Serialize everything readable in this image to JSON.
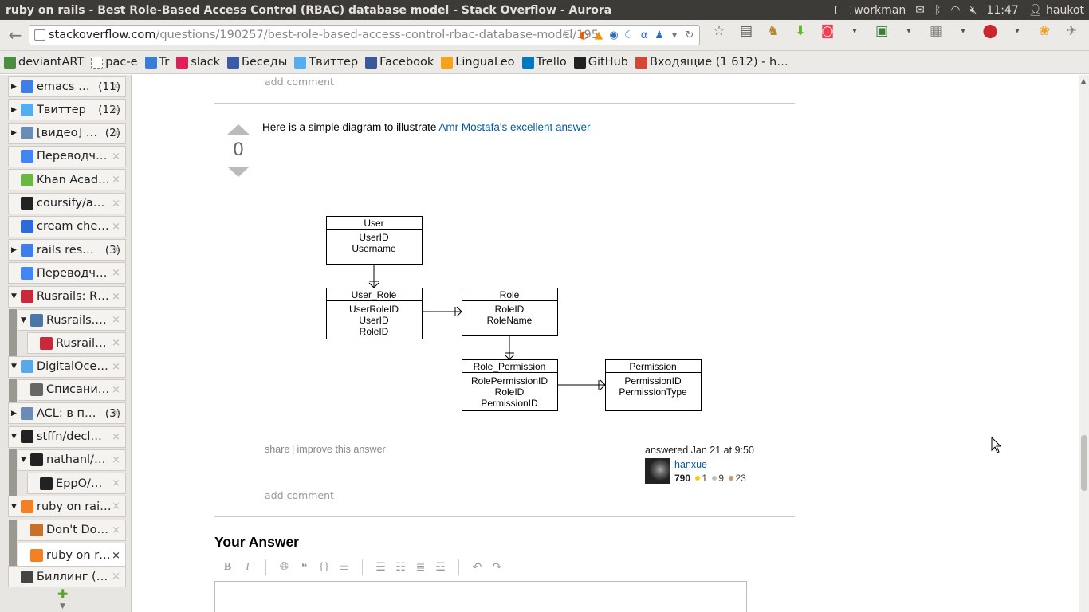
{
  "window": {
    "title": "ruby on rails - Best Role-Based Access Control (RBAC) database model - Stack Overflow - Aurora"
  },
  "system_tray": {
    "keyboard_layout": "workman",
    "time": "11:47",
    "user": "haukot"
  },
  "url": {
    "host": "stackoverflow.com",
    "path": "/questions/190257/best-role-based-access-control-rbac-database-model/195"
  },
  "bookmarks": [
    {
      "label": "deviantART",
      "icon_color": "#4a8e3f"
    },
    {
      "label": "рас-е",
      "icon_color": "#ffffff"
    },
    {
      "label": "Tr",
      "icon_color": "#3a7bd5"
    },
    {
      "label": "slack",
      "icon_color": "#e01e5a"
    },
    {
      "label": "Беседы",
      "icon_color": "#3b5ba7"
    },
    {
      "label": "Твиттер",
      "icon_color": "#55acee"
    },
    {
      "label": "Facebook",
      "icon_color": "#3b5998"
    },
    {
      "label": "LinguaLeo",
      "icon_color": "#f6a21e"
    },
    {
      "label": "Trello",
      "icon_color": "#0079bf"
    },
    {
      "label": "GitHub",
      "icon_color": "#222222"
    },
    {
      "label": "Входящие (1 612) - h…",
      "icon_color": "#d14836"
    }
  ],
  "sidebar": {
    "tabs": [
      {
        "label": "emacs …",
        "count": "(11)",
        "icon": "google-icon",
        "icon_color": "#3f7ee8",
        "twisty": "▶"
      },
      {
        "label": "Твиттер",
        "count": "(12)",
        "icon": "twitter-icon",
        "icon_color": "#55acee",
        "twisty": "▶"
      },
      {
        "label": "[видео] …",
        "count": "(2)",
        "icon": "page-icon",
        "icon_color": "#6a8bb3",
        "twisty": "▶"
      },
      {
        "label": "Переводч…",
        "count": "",
        "icon": "translate-icon",
        "icon_color": "#4285f4",
        "twisty": ""
      },
      {
        "label": "Khan Acad…",
        "count": "",
        "icon": "leaf-icon",
        "icon_color": "#69b745",
        "twisty": ""
      },
      {
        "label": "coursify/a…",
        "count": "",
        "icon": "github-icon",
        "icon_color": "#222",
        "twisty": ""
      },
      {
        "label": "cream che…",
        "count": "",
        "icon": "c-icon",
        "icon_color": "#2c6bd9",
        "twisty": ""
      },
      {
        "label": "rails res…",
        "count": "(3)",
        "icon": "google-icon",
        "icon_color": "#3f7ee8",
        "twisty": "▶"
      },
      {
        "label": "Переводч…",
        "count": "",
        "icon": "translate-icon",
        "icon_color": "#4285f4",
        "twisty": ""
      },
      {
        "label": "Rusrails: R…",
        "count": "",
        "icon": "rusrails-icon",
        "icon_color": "#c8283a",
        "twisty": "▼"
      },
      {
        "label": "Rusrails.…",
        "count": "",
        "icon": "vk-icon",
        "icon_color": "#4a76a8",
        "twisty": "▼"
      },
      {
        "label": "Rusrail…",
        "count": "",
        "icon": "rusrails-icon",
        "icon_color": "#c8283a",
        "twisty": ""
      },
      {
        "label": "DigitalOce…",
        "count": "",
        "icon": "cloud-icon",
        "icon_color": "#5aa9e6",
        "twisty": "▼"
      },
      {
        "label": "Списани…",
        "count": "",
        "icon": "cloud-icon",
        "icon_color": "#666",
        "twisty": ""
      },
      {
        "label": "ACL: в п…",
        "count": "(3)",
        "icon": "page-icon",
        "icon_color": "#6a8bb3",
        "twisty": "▶"
      },
      {
        "label": "stffn/decl…",
        "count": "",
        "icon": "github-icon",
        "icon_color": "#222",
        "twisty": "▼"
      },
      {
        "label": "nathanl/…",
        "count": "",
        "icon": "github-icon",
        "icon_color": "#222",
        "twisty": "▼"
      },
      {
        "label": "EppO/…",
        "count": "",
        "icon": "github-icon",
        "icon_color": "#222",
        "twisty": ""
      },
      {
        "label": "ruby on rai…",
        "count": "",
        "icon": "stackoverflow-icon",
        "icon_color": "#f48024",
        "twisty": "▼"
      },
      {
        "label": "Don't Do…",
        "count": "",
        "icon": "stackoverflow-icon",
        "icon_color": "#c8702a",
        "twisty": ""
      },
      {
        "label": "ruby on r…",
        "count": "",
        "icon": "stackoverflow-icon",
        "icon_color": "#f48024",
        "twisty": ""
      },
      {
        "label": "Биллинг (…",
        "count": "",
        "icon": "wikipedia-icon",
        "icon_color": "#444",
        "twisty": ""
      }
    ]
  },
  "answer": {
    "add_comment_top": "add comment",
    "vote_count": "0",
    "text_prefix": "Here is a simple diagram to illustrate ",
    "link_text": "Amr Mostafa's excellent answer",
    "share": "share",
    "improve": "improve this answer",
    "answered": "answered Jan 21 at 9:50",
    "user_name": "hanxue",
    "reputation": "790",
    "badge_gold": "1",
    "badge_silver": "9",
    "badge_bronze": "23",
    "add_comment_bottom": "add comment"
  },
  "diagram": {
    "tables": [
      {
        "name": "User",
        "fields": [
          "UserID",
          "Username"
        ]
      },
      {
        "name": "User_Role",
        "fields": [
          "UserRoleID",
          "UserID",
          "RoleID"
        ]
      },
      {
        "name": "Role",
        "fields": [
          "RoleID",
          "RoleName"
        ]
      },
      {
        "name": "Role_Permission",
        "fields": [
          "RolePermissionID",
          "RoleID",
          "PermissionID"
        ]
      },
      {
        "name": "Permission",
        "fields": [
          "PermissionID",
          "PermissionType"
        ]
      }
    ]
  },
  "your_answer": {
    "heading": "Your Answer"
  },
  "colors": {
    "link": "#0a5a9c",
    "gold": "#ffcc00",
    "silver": "#c0c0c0",
    "bronze": "#cc9966"
  }
}
